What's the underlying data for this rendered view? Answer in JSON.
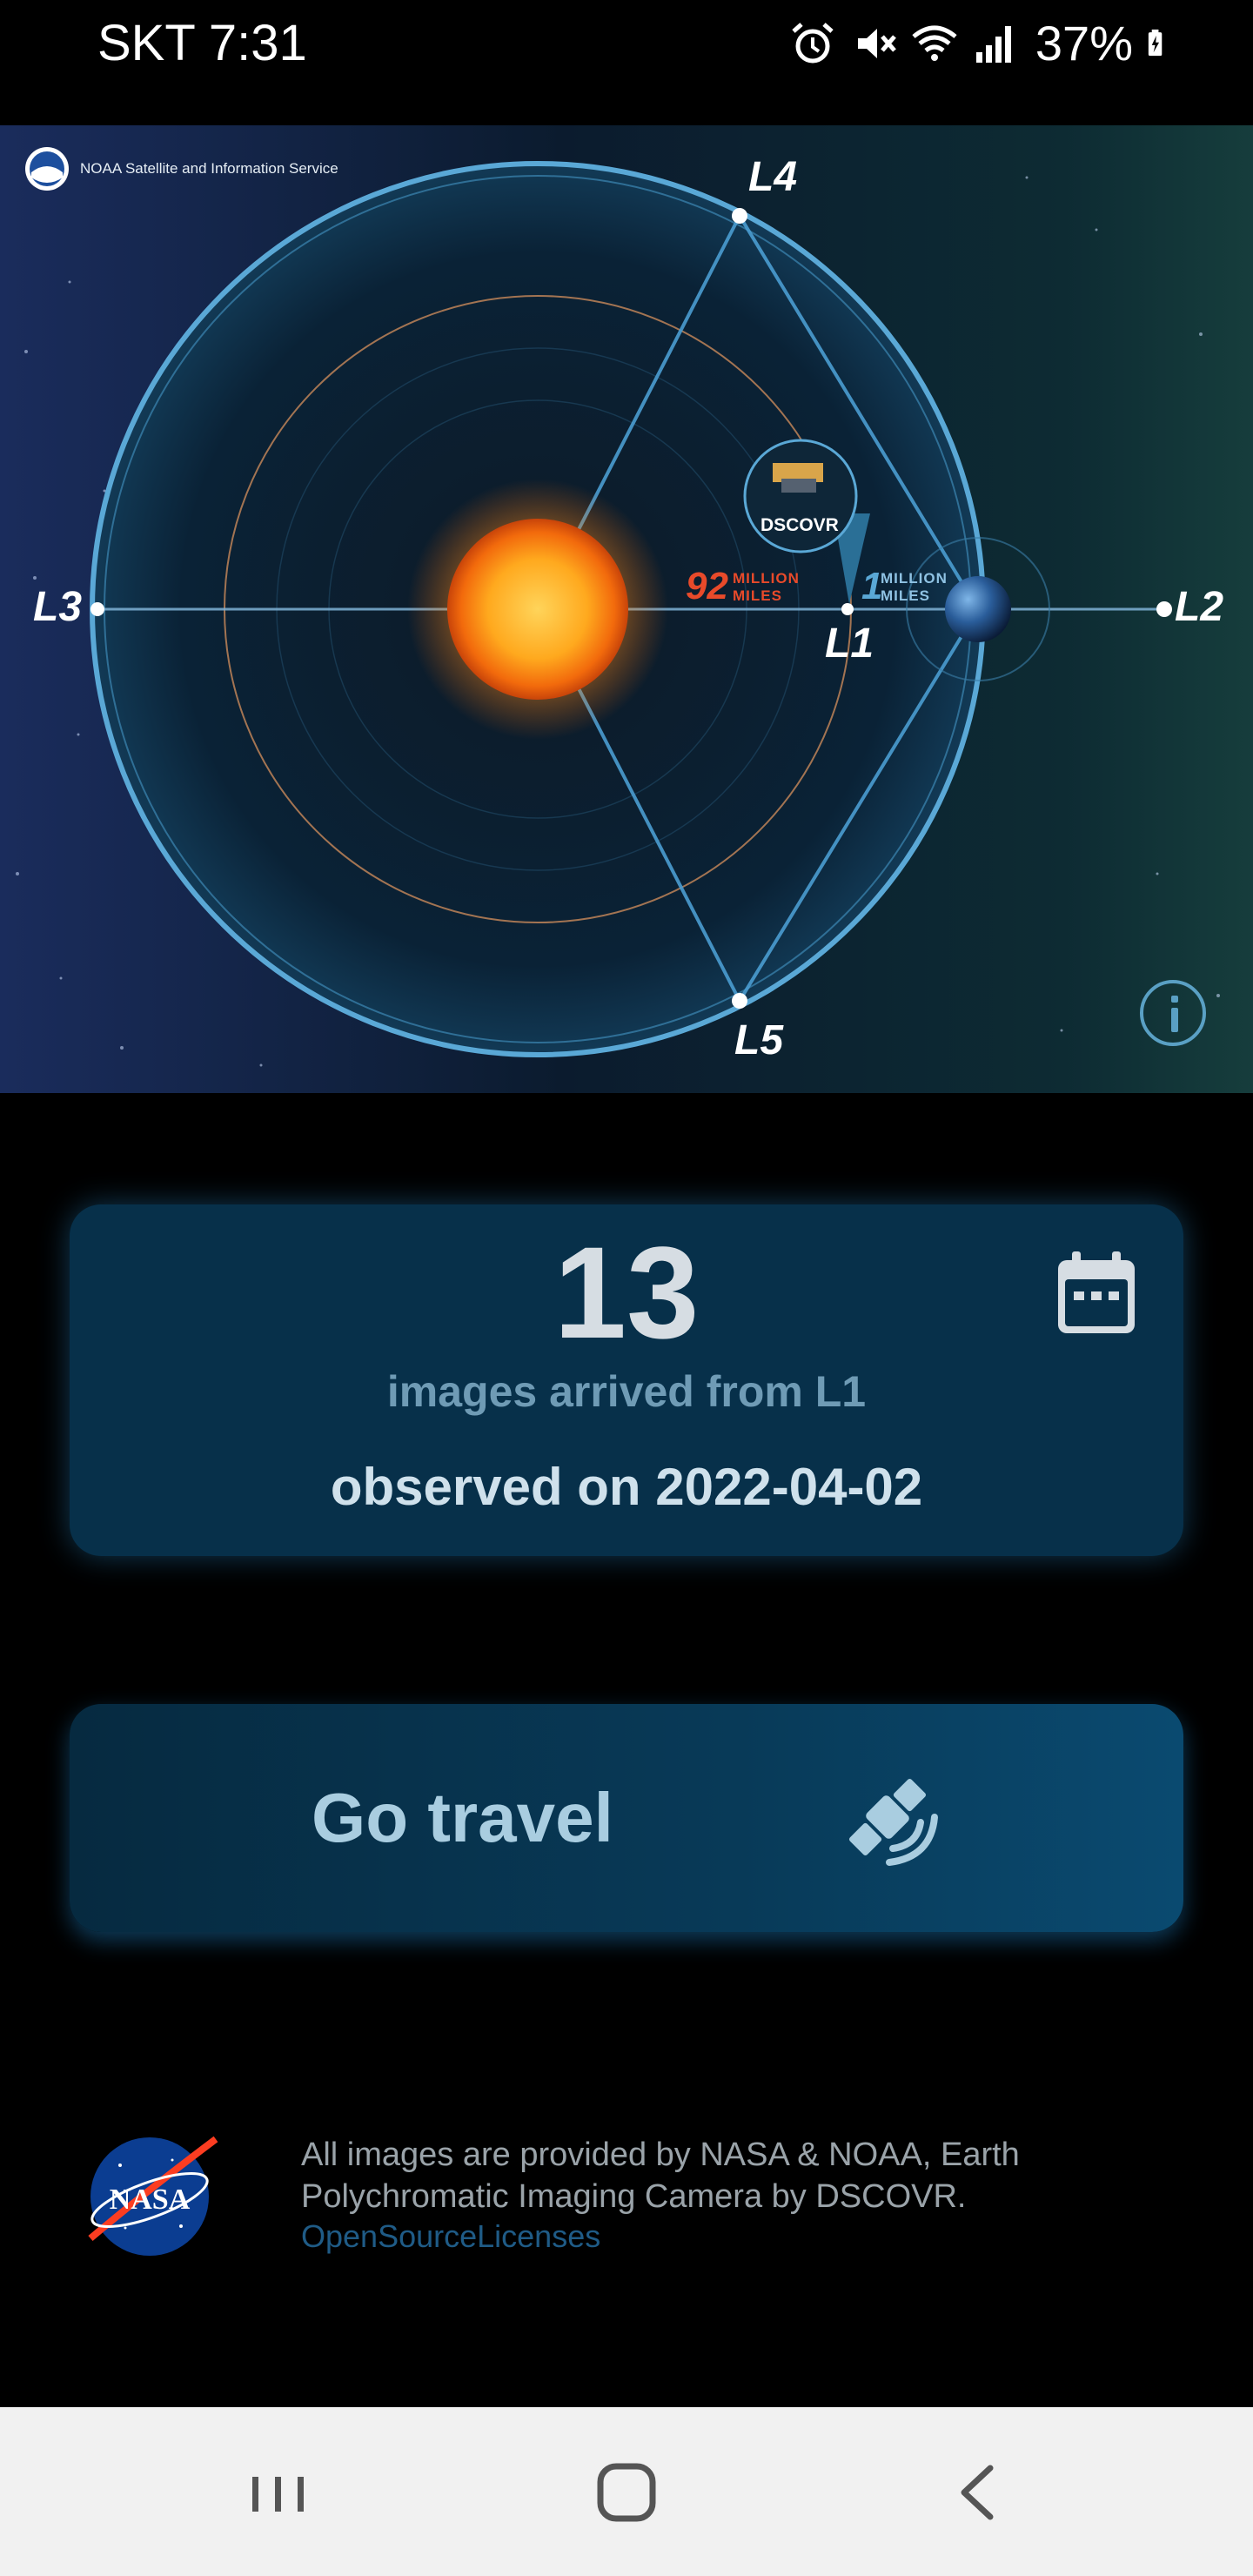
{
  "status_bar": {
    "carrier_time": "SKT 7:31",
    "battery": "37%",
    "icons": [
      "alarm-icon",
      "mute-icon",
      "wifi-icon",
      "signal-icon",
      "battery-charging-icon"
    ]
  },
  "hero": {
    "noaa_caption": "NOAA Satellite and Information Service",
    "lagrange_points": {
      "l1": "L1",
      "l2": "L2",
      "l3": "L3",
      "l4": "L4",
      "l5": "L5"
    },
    "satellite_name": "DSCOVR",
    "sun_distance": {
      "number": "92",
      "word1": "MILLION",
      "word2": "MILES"
    },
    "earth_distance": {
      "number": "1",
      "word1": "MILLION",
      "word2": "MILES"
    },
    "info_icon": "info-icon"
  },
  "count_card": {
    "count": "13",
    "subtitle": "images arrived from L1",
    "date_line": "observed on 2022-04-02",
    "calendar_icon": "calendar-icon"
  },
  "travel_button": {
    "label": "Go travel",
    "icon": "satellite-icon"
  },
  "footer": {
    "credits": "All images are provided by NASA & NOAA, Earth Polychromatic Imaging Camera by DSCOVR.",
    "licenses_link": "OpenSourceLicenses",
    "logo": "nasa-logo"
  },
  "colors": {
    "card_bg": "#07304a",
    "button_text": "#a9cde0",
    "link": "#1f5b86",
    "orbit": "#5aa8d6"
  },
  "nav_bar": {
    "buttons": [
      "recent-apps-icon",
      "home-icon",
      "back-icon"
    ]
  }
}
